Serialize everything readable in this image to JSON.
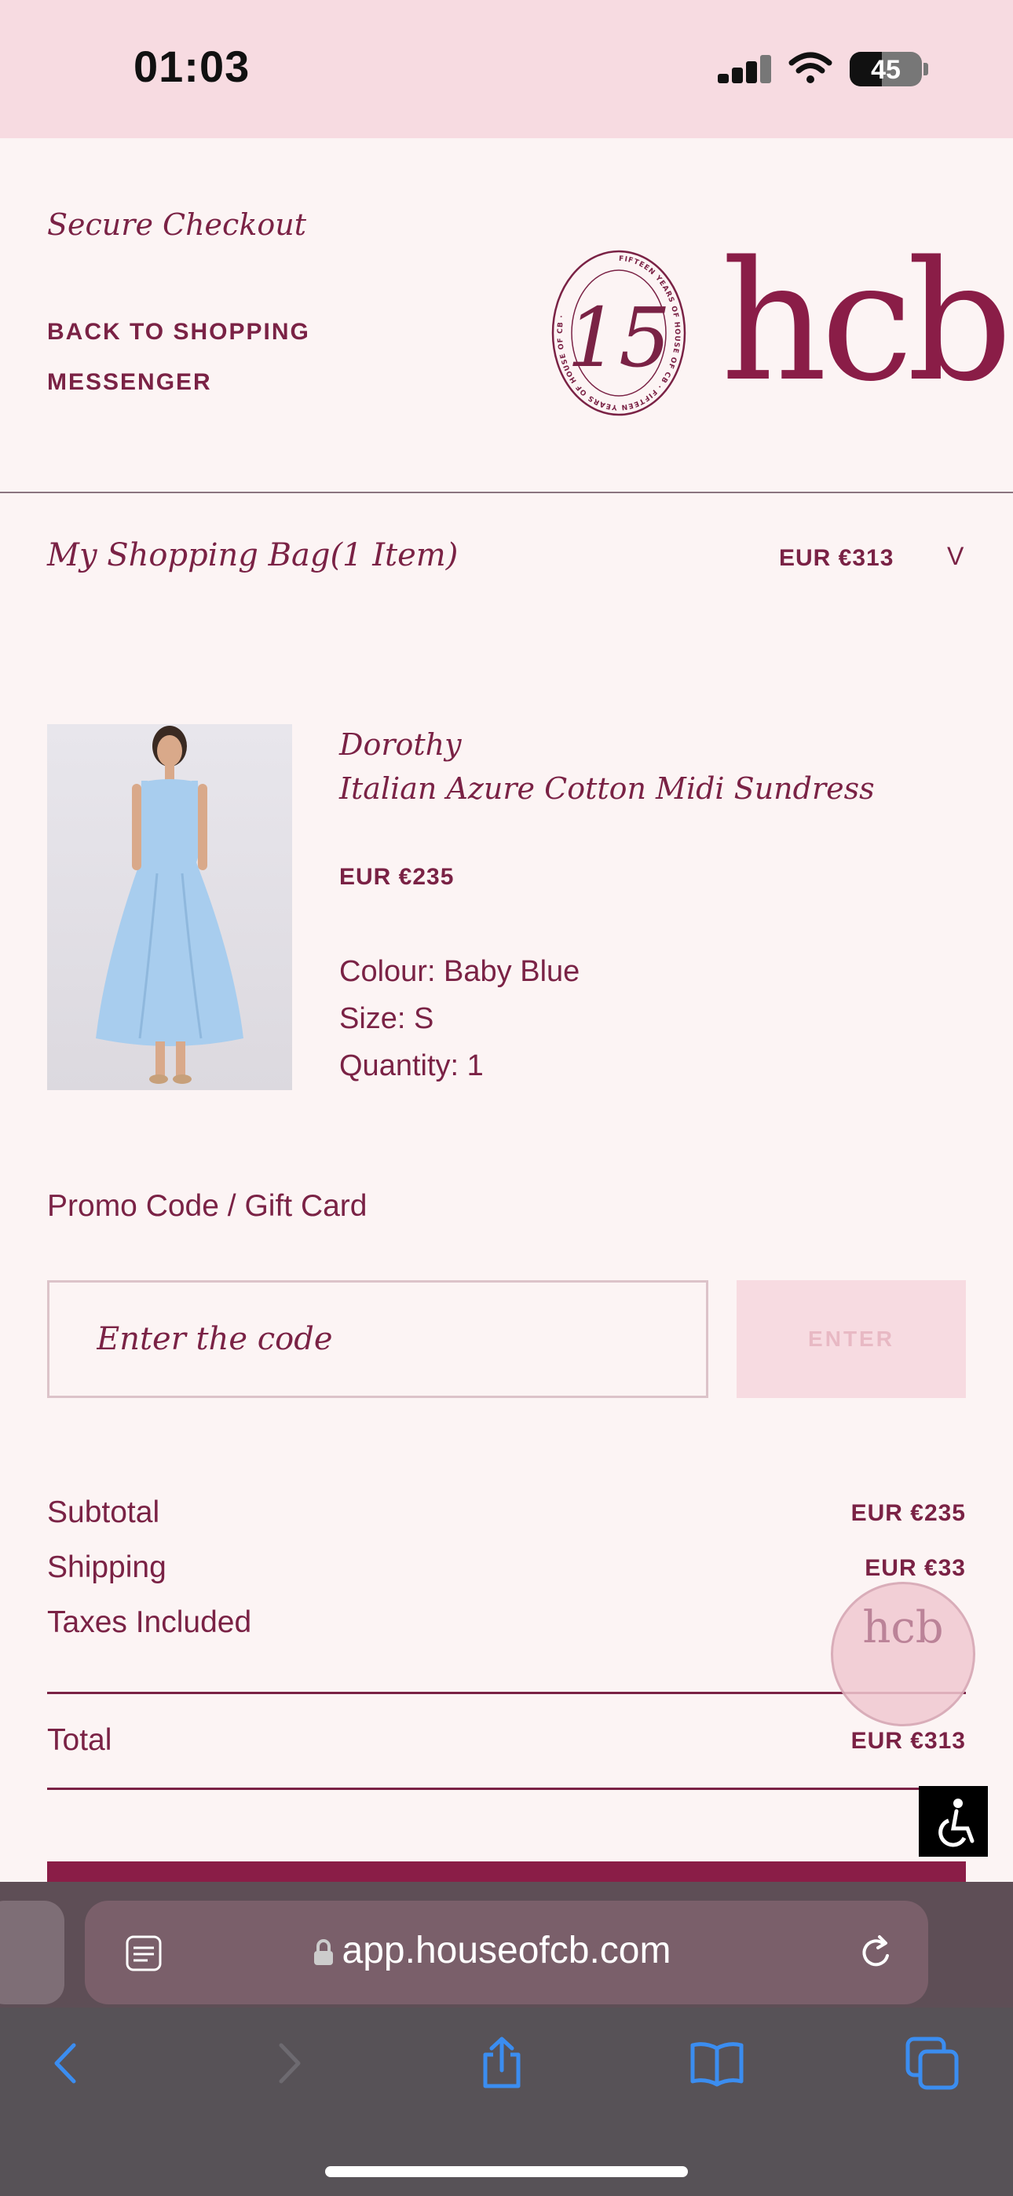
{
  "status_bar": {
    "time": "01:03",
    "battery": "45",
    "battery_level": 0.45
  },
  "header": {
    "secure_checkout": "Secure Checkout",
    "back_to_shopping": "BACK TO SHOPPING",
    "messenger": "MESSENGER",
    "logo": {
      "badge_number": "15",
      "badge_ring_text": "FIFTEEN YEARS OF HOUSE OF CB · FIFTEEN YEARS OF HOUSE OF CB ·",
      "brand": "hcb"
    }
  },
  "bag": {
    "title": "My Shopping Bag(1 Item)",
    "total": "EUR €313",
    "toggle": "V"
  },
  "product": {
    "name_line1": "Dorothy",
    "name_line2": "Italian Azure Cotton Midi Sundress",
    "price": "EUR €235",
    "colour": "Colour: Baby Blue",
    "size": "Size: S",
    "quantity": "Quantity: 1"
  },
  "promo": {
    "label": "Promo Code / Gift Card",
    "placeholder": "Enter the code",
    "value": "",
    "button": "ENTER"
  },
  "summary": {
    "subtotal_label": "Subtotal",
    "subtotal": "EUR €235",
    "shipping_label": "Shipping",
    "shipping": "EUR €33",
    "taxes_label": "Taxes Included",
    "total_label": "Total",
    "total": "EUR €313"
  },
  "chat_badge": {
    "text": "hcb"
  },
  "safari": {
    "url": "app.houseofcb.com"
  },
  "colors": {
    "brand": "#7a2245",
    "accent_pink": "#f7dbe1",
    "background": "#fcf4f4"
  }
}
